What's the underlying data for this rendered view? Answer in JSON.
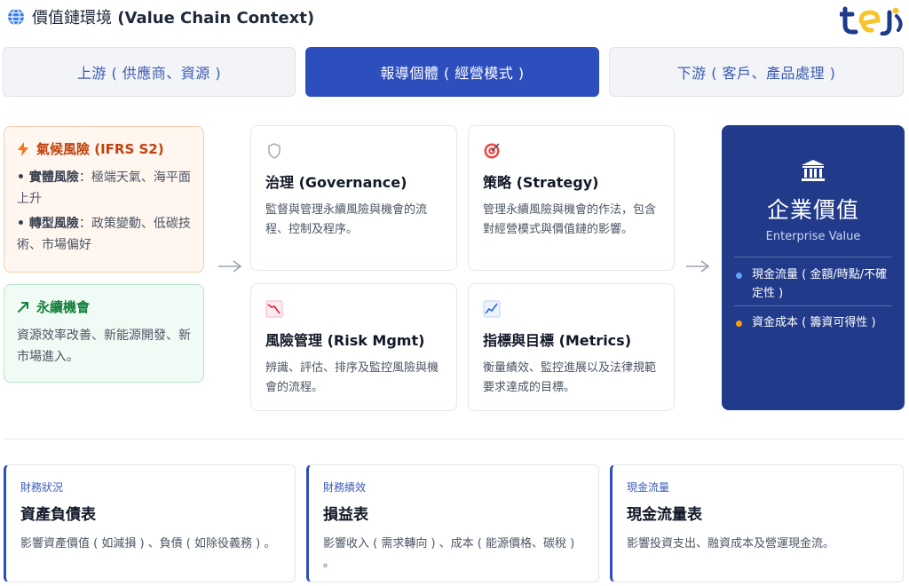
{
  "header": {
    "title_cjk": "價值鏈環境",
    "title_en": "(Value Chain Context)",
    "logo_text": "tej",
    "colors": {
      "brand_blue": "#1e3a8a",
      "brand_yellow": "#f6c42b"
    }
  },
  "tabs": [
    {
      "label": "上游 ( 供應商、資源 )",
      "active": false
    },
    {
      "label": "報導個體 ( 經營模式 )",
      "active": true
    },
    {
      "label": "下游 ( 客戶、產品處理 )",
      "active": false
    }
  ],
  "climate_risk": {
    "icon": "lightning-icon",
    "title": "氣候風險 (IFRS S2)",
    "items": [
      {
        "label": "• 實體風險",
        "text": "：極端天氣、海平面上升"
      },
      {
        "label": "• 轉型風險",
        "text": "：政策變動、低碳技術、市場偏好"
      }
    ]
  },
  "sustainability_opportunity": {
    "icon": "trend-up-icon",
    "title": "永續機會",
    "text": "資源效率改善、新能源開發、新市場進入。"
  },
  "pillars": [
    {
      "icon": "shield-icon",
      "title": "治理 (Governance)",
      "desc": "監督與管理永續風險與機會的流程、控制及程序。"
    },
    {
      "icon": "target-icon",
      "title": "策略 (Strategy)",
      "desc": "管理永續風險與機會的作法，包含對經營模式與價值鏈的影響。"
    },
    {
      "icon": "chart-down-icon",
      "title": "風險管理 (Risk Mgmt)",
      "desc": "辨識、評估、排序及監控風險與機會的流程。"
    },
    {
      "icon": "chart-up-icon",
      "title": "指標與目標 (Metrics)",
      "desc": "衡量績效、監控進展以及法律規範要求達成的目標。"
    }
  ],
  "enterprise_value": {
    "icon": "bank-icon",
    "title": "企業價值",
    "subtitle": "Enterprise Value",
    "items": [
      {
        "text": "現金流量 ( 金額/時點/不確定性 )",
        "dot_color": "#60a5fa"
      },
      {
        "text": "資金成本 ( 籌資可得性 )",
        "dot_color": "#f59e0b"
      }
    ]
  },
  "statements": [
    {
      "category": "財務狀況",
      "title": "資產負債表",
      "desc": "影響資產價值 ( 如減損 ) 、負債 ( 如除役義務 ) 。"
    },
    {
      "category": "財務績效",
      "title": "損益表",
      "desc": "影響收入 ( 需求轉向 ) 、成本 ( 能源價格、碳稅 ) 。"
    },
    {
      "category": "現金流量",
      "title": "現金流量表",
      "desc": "影響投資支出、融資成本及營運現金流。"
    }
  ]
}
